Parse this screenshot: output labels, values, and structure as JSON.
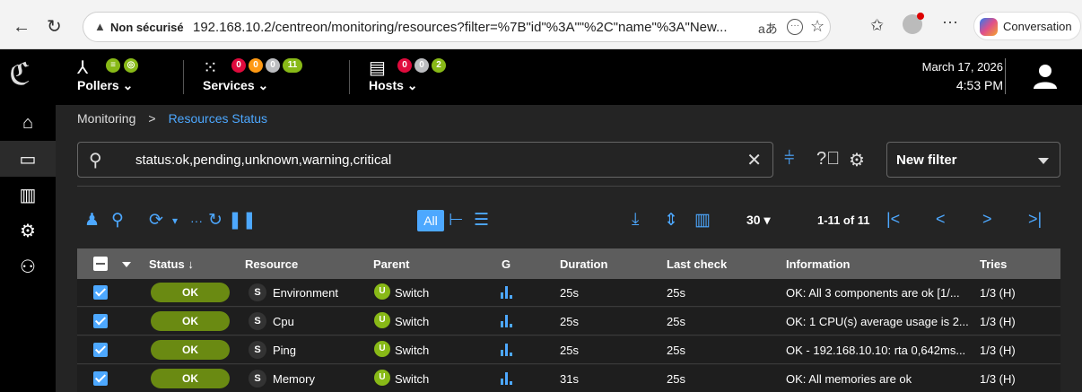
{
  "browser": {
    "insecure_label": "Non sécurisé",
    "url": "192.168.10.2/centreon/monitoring/resources?filter=%7B\"id\"%3A\"\"%2C\"name\"%3A\"New...",
    "copilot_label": "Conversation"
  },
  "header": {
    "pollers_label": "Pollers",
    "services_label": "Services",
    "services_counts": [
      "0",
      "0",
      "0",
      "11"
    ],
    "hosts_label": "Hosts",
    "hosts_counts": [
      "0",
      "0",
      "2"
    ],
    "date": "March 17, 2026",
    "time": "4:53 PM"
  },
  "breadcrumb": {
    "root": "Monitoring",
    "current": "Resources Status"
  },
  "search": {
    "value": "status:ok,pending,unknown,warning,critical"
  },
  "filter_select": {
    "value": "New filter"
  },
  "toolbar": {
    "view_all": "All",
    "per_page": "30",
    "pagination": "1-11 of 11"
  },
  "table": {
    "columns": [
      "Status",
      "Resource",
      "Parent",
      "G",
      "Duration",
      "Last check",
      "Information",
      "Tries"
    ],
    "rows": [
      {
        "status": "OK",
        "type": "S",
        "resource": "Environment",
        "parent_type": "U",
        "parent": "Switch",
        "duration": "25s",
        "last_check": "25s",
        "information": "OK: All 3 components are ok [1/...",
        "tries": "1/3 (H)"
      },
      {
        "status": "OK",
        "type": "S",
        "resource": "Cpu",
        "parent_type": "U",
        "parent": "Switch",
        "duration": "25s",
        "last_check": "25s",
        "information": "OK: 1 CPU(s) average usage is 2...",
        "tries": "1/3 (H)"
      },
      {
        "status": "OK",
        "type": "S",
        "resource": "Ping",
        "parent_type": "U",
        "parent": "Switch",
        "duration": "25s",
        "last_check": "25s",
        "information": "OK - 192.168.10.10: rta 0,642ms...",
        "tries": "1/3 (H)"
      },
      {
        "status": "OK",
        "type": "S",
        "resource": "Memory",
        "parent_type": "U",
        "parent": "Switch",
        "duration": "31s",
        "last_check": "25s",
        "information": "OK: All memories are ok",
        "tries": "1/3 (H)"
      }
    ]
  },
  "colors": {
    "accent": "#4da8ff",
    "ok_status": "#6a8a12",
    "critical": "#e00b3d",
    "warning": "#ff9913",
    "unknown": "#bcbdc0",
    "ok_badge": "#88b917"
  }
}
